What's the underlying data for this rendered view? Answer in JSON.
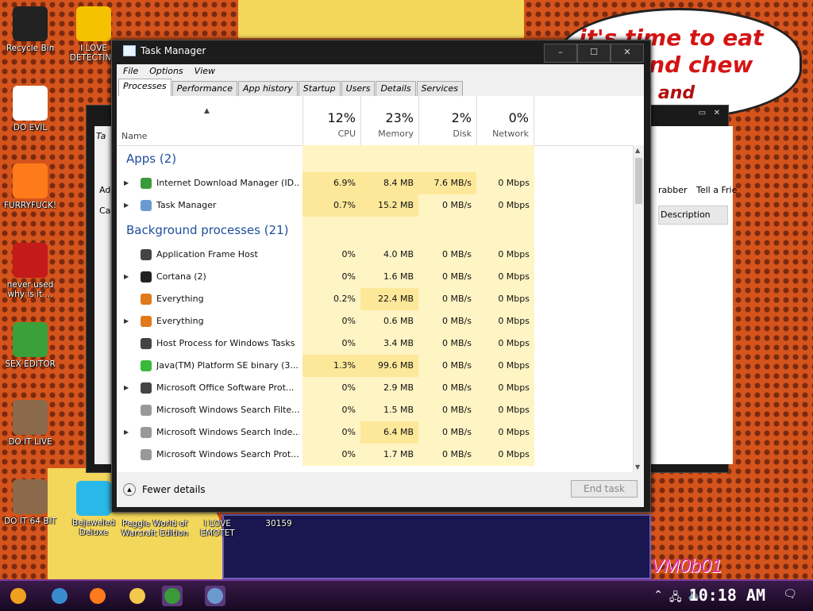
{
  "desktop": {
    "icons": [
      {
        "label": "Recycle Bin",
        "color": "#222"
      },
      {
        "label": "DO EVIL",
        "color": "#ffffff"
      },
      {
        "label": "FURRYFUCK!",
        "color": "#ff7a1a"
      },
      {
        "label": "never used why is it ...",
        "color": "#c41a1a"
      },
      {
        "label": "SEX EDITOR",
        "color": "#3aa03a"
      },
      {
        "label": "DO IT LIVE",
        "color": "#8a6a4a"
      },
      {
        "label": "DO IT 64 BIT",
        "color": "#8a6a4a"
      },
      {
        "label": "I LOVE DETECTING",
        "color": "#f4c200"
      },
      {
        "label": "Bejeweled Deluxe",
        "color": "#2ab8e8"
      }
    ],
    "bottom_labels": [
      "Peggle World of Warcraft Edition",
      "I LOVE EMOTET",
      "30159"
    ],
    "bubble_text": "it's time to eat shit and chew",
    "bubble_text2": "os and",
    "watermark": "VM0b01",
    "bg_window": {
      "title": "Ta",
      "col_header": "Description",
      "items": [
        "rabber",
        "Tell a Frie"
      ],
      "left_labels": [
        "Ad",
        "Ca"
      ]
    }
  },
  "task_manager": {
    "title": "Task Manager",
    "controls": [
      "–",
      "☐",
      "✕"
    ],
    "menu": [
      "File",
      "Options",
      "View"
    ],
    "tabs": [
      "Processes",
      "Performance",
      "App history",
      "Startup",
      "Users",
      "Details",
      "Services"
    ],
    "active_tab": "Processes",
    "header": {
      "name": "Name",
      "cpu": {
        "pct": "12%",
        "label": "CPU"
      },
      "memory": {
        "pct": "23%",
        "label": "Memory"
      },
      "disk": {
        "pct": "2%",
        "label": "Disk"
      },
      "network": {
        "pct": "0%",
        "label": "Network"
      }
    },
    "groups": [
      {
        "title": "Apps (2)",
        "rows": [
          {
            "name": "Internet Download Manager (ID...",
            "exp": true,
            "cpu": "6.9%",
            "mem": "8.4 MB",
            "disk": "7.6 MB/s",
            "net": "0 Mbps",
            "icon": "#3a9a3a"
          },
          {
            "name": "Task Manager",
            "exp": true,
            "cpu": "0.7%",
            "mem": "15.2 MB",
            "disk": "0 MB/s",
            "net": "0 Mbps",
            "icon": "#6a9ad0"
          }
        ]
      },
      {
        "title": "Background processes (21)",
        "rows": [
          {
            "name": "Application Frame Host",
            "exp": false,
            "cpu": "0%",
            "mem": "4.0 MB",
            "disk": "0 MB/s",
            "net": "0 Mbps",
            "icon": "#444"
          },
          {
            "name": "Cortana (2)",
            "exp": true,
            "cpu": "0%",
            "mem": "1.6 MB",
            "disk": "0 MB/s",
            "net": "0 Mbps",
            "icon": "#222"
          },
          {
            "name": "Everything",
            "exp": false,
            "cpu": "0.2%",
            "mem": "22.4 MB",
            "disk": "0 MB/s",
            "net": "0 Mbps",
            "icon": "#e07a1a"
          },
          {
            "name": "Everything",
            "exp": true,
            "cpu": "0%",
            "mem": "0.6 MB",
            "disk": "0 MB/s",
            "net": "0 Mbps",
            "icon": "#e07a1a"
          },
          {
            "name": "Host Process for Windows Tasks",
            "exp": false,
            "cpu": "0%",
            "mem": "3.4 MB",
            "disk": "0 MB/s",
            "net": "0 Mbps",
            "icon": "#444"
          },
          {
            "name": "Java(TM) Platform SE binary (3...",
            "exp": false,
            "cpu": "1.3%",
            "mem": "99.6 MB",
            "disk": "0 MB/s",
            "net": "0 Mbps",
            "icon": "#3ab83a"
          },
          {
            "name": "Microsoft Office Software Prot...",
            "exp": true,
            "cpu": "0%",
            "mem": "2.9 MB",
            "disk": "0 MB/s",
            "net": "0 Mbps",
            "icon": "#444"
          },
          {
            "name": "Microsoft Windows Search Filte...",
            "exp": false,
            "cpu": "0%",
            "mem": "1.5 MB",
            "disk": "0 MB/s",
            "net": "0 Mbps",
            "icon": "#999"
          },
          {
            "name": "Microsoft Windows Search Inde...",
            "exp": true,
            "cpu": "0%",
            "mem": "6.4 MB",
            "disk": "0 MB/s",
            "net": "0 Mbps",
            "icon": "#999"
          },
          {
            "name": "Microsoft Windows Search Prot...",
            "exp": false,
            "cpu": "0%",
            "mem": "1.7 MB",
            "disk": "0 MB/s",
            "net": "0 Mbps",
            "icon": "#999"
          }
        ]
      }
    ],
    "footer": {
      "fewer_details": "Fewer details",
      "end_task": "End task"
    }
  },
  "taskbar": {
    "clock": "10:18 AM",
    "apps": [
      {
        "name": "start",
        "color": "#f0a020"
      },
      {
        "name": "chrome",
        "color": "#3a8ad0"
      },
      {
        "name": "firefox",
        "color": "#ff7a1a"
      },
      {
        "name": "explorer",
        "color": "#f4c84a"
      },
      {
        "name": "idm",
        "color": "#3a9a3a"
      },
      {
        "name": "taskmgr",
        "color": "#6a9ad0"
      }
    ]
  }
}
